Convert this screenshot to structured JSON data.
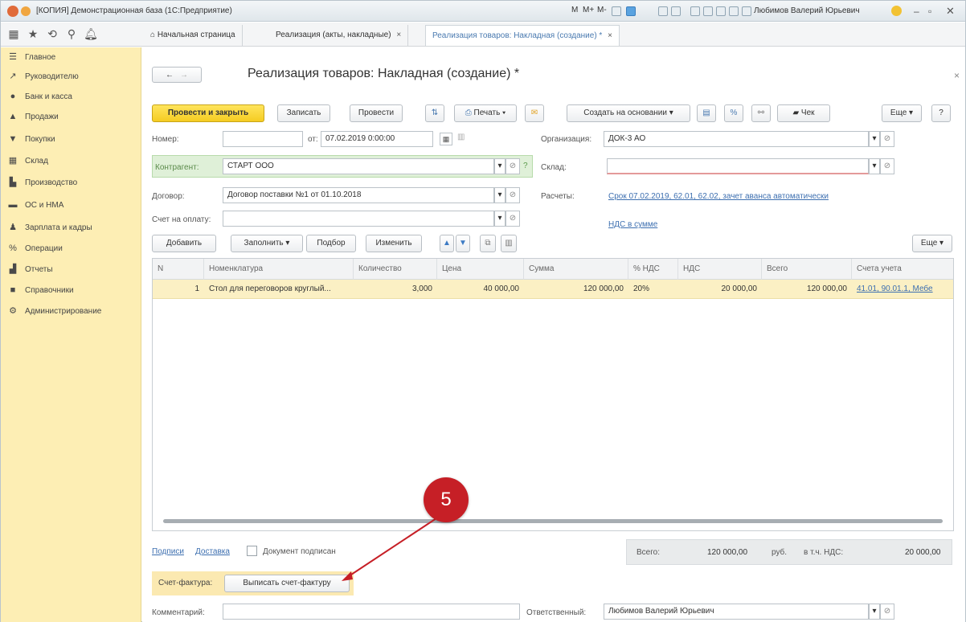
{
  "window": {
    "title": "[КОПИЯ] Демонстрационная база (1С:Предприятие)",
    "user": "Любимов Валерий Юрьевич",
    "toolbar_letters": [
      "M",
      "M+",
      "M-"
    ]
  },
  "tabs": [
    {
      "label": "Начальная страница"
    },
    {
      "label": "Реализация (акты, накладные)",
      "close": "×"
    },
    {
      "label": "Реализация товаров: Накладная (создание) *",
      "close": "×"
    }
  ],
  "sidebar": {
    "items": [
      {
        "label": "Главное",
        "icon": "☰"
      },
      {
        "label": "Руководителю",
        "icon": "↗"
      },
      {
        "label": "Банк и касса",
        "icon": "●"
      },
      {
        "label": "Продажи",
        "icon": "▲"
      },
      {
        "label": "Покупки",
        "icon": "▼"
      },
      {
        "label": "Склад",
        "icon": "▦"
      },
      {
        "label": "Производство",
        "icon": "▙"
      },
      {
        "label": "ОС и НМА",
        "icon": "▬"
      },
      {
        "label": "Зарплата и кадры",
        "icon": "♟"
      },
      {
        "label": "Операции",
        "icon": "%"
      },
      {
        "label": "Отчеты",
        "icon": "▟"
      },
      {
        "label": "Справочники",
        "icon": "■"
      },
      {
        "label": "Администрирование",
        "icon": "⚙"
      }
    ]
  },
  "doc": {
    "back": "←",
    "forward": "→",
    "title": "Реализация товаров: Накладная (создание) *",
    "close": "×"
  },
  "toolbar": {
    "post_close": "Провести и закрыть",
    "save": "Записать",
    "post": "Провести",
    "print": "Печать",
    "create_based": "Создать на основании",
    "check": "Чек",
    "more": "Еще",
    "help": "?"
  },
  "form": {
    "number_label": "Номер:",
    "number_value": "",
    "from_label": "от:",
    "date_value": "07.02.2019  0:00:00",
    "org_label": "Организация:",
    "org_value": "ДОК-3 АО",
    "contractor_label": "Контрагент:",
    "contractor_value": "СТАРТ ООО",
    "warehouse_label": "Склад:",
    "warehouse_value": "",
    "contract_label": "Договор:",
    "contract_value": "Договор поставки №1 от 01.10.2018",
    "settlements_label": "Расчеты:",
    "settlements_link": "Срок 07.02.2019, 62.01, 62.02, зачет аванса автоматически",
    "invoice_label": "Счет на оплату:",
    "invoice_value": "",
    "vat_link": "НДС в сумме",
    "question": "?"
  },
  "table_toolbar": {
    "add": "Добавить",
    "fill": "Заполнить",
    "pick": "Подбор",
    "change": "Изменить",
    "more": "Еще"
  },
  "table": {
    "headers": [
      "N",
      "Номенклатура",
      "Количество",
      "Цена",
      "Сумма",
      "% НДС",
      "НДС",
      "Всего",
      "Счета учета"
    ],
    "rows": [
      [
        "1",
        "Стол для переговоров круглый...",
        "3,000",
        "40 000,00",
        "120 000,00",
        "20%",
        "20 000,00",
        "120 000,00",
        "41.01, 90.01.1, Мебе"
      ]
    ]
  },
  "footer": {
    "sign_link": "Подписи",
    "delivery_link": "Доставка",
    "signed_label": "Документ подписан",
    "total_label": "Всего:",
    "total_value": "120 000,00",
    "currency": "руб.",
    "vat_label": "в т.ч. НДС:",
    "vat_value": "20 000,00",
    "sf_label": "Счет-фактура:",
    "sf_button": "Выписать счет-фактуру",
    "comment_label": "Комментарий:",
    "comment_value": "",
    "responsible_label": "Ответственный:",
    "responsible_value": "Любимов Валерий Юрьевич"
  },
  "annotation": {
    "step": "5",
    "color": "#c61f26"
  }
}
